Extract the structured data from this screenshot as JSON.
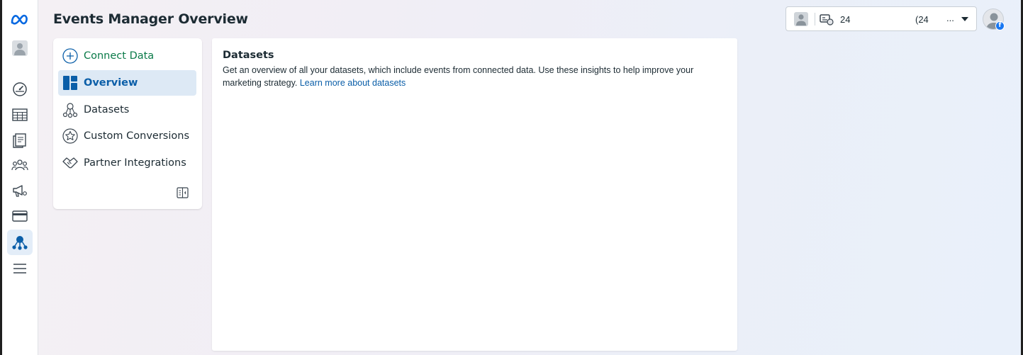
{
  "header": {
    "title": "Events Manager Overview"
  },
  "account_selector": {
    "id_text": "24",
    "secondary_text": "(24",
    "more": "..."
  },
  "rail": {
    "items": [
      "meta-logo-icon",
      "user-avatar",
      "gauge-icon",
      "table-icon",
      "catalog-icon",
      "audience-icon",
      "megaphone-icon",
      "billing-card-icon",
      "events-manager-icon",
      "menu-icon"
    ],
    "active": "events-manager-icon"
  },
  "nav": {
    "connect_data": "Connect Data",
    "overview": "Overview",
    "datasets": "Datasets",
    "custom_conversions": "Custom Conversions",
    "partner_integrations": "Partner Integrations",
    "active": "Overview"
  },
  "main": {
    "title": "Datasets",
    "description": "Get an overview of all your datasets, which include events from connected data. Use these insights to help improve your marketing strategy.",
    "learn_more": "Learn more about datasets"
  },
  "colors": {
    "accent_blue": "#0a5ea8",
    "connect_green": "#0a7a48",
    "active_bg": "#dde9f5",
    "meta_blue": "#0668e1"
  }
}
